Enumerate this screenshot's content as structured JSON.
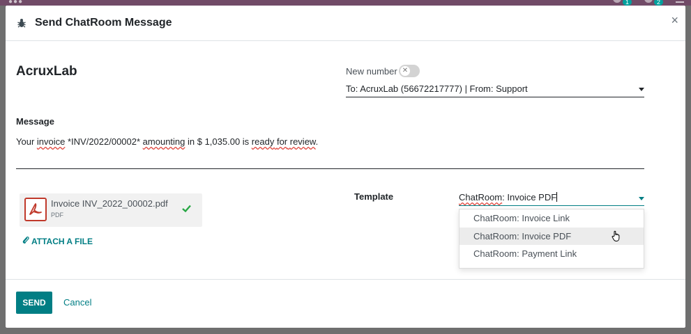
{
  "dialog": {
    "title": "Send ChatRoom Message",
    "close_symbol": "×"
  },
  "partner": {
    "name": "AcruxLab"
  },
  "new_number": {
    "label": "New number",
    "enabled": false
  },
  "conversation": {
    "selected": "To: AcruxLab (56672217777) | From: Support"
  },
  "message": {
    "label": "Message",
    "parts": {
      "p1": "Your ",
      "p2": "invoice",
      "p3": " *INV/2022/00002* ",
      "p4": "amounting",
      "p5": " in $ 1,035.00 is ",
      "p6": "ready",
      "p7": " ",
      "p8": "for",
      "p9": " ",
      "p10": "review",
      "p11": "."
    }
  },
  "attachment": {
    "name": "Invoice INV_2022_00002.pdf",
    "type": "PDF",
    "attach_label": "ATTACH A FILE"
  },
  "template": {
    "label": "Template",
    "value_part1": "ChatRoom",
    "value_part2": ": Invoice PDF",
    "options": [
      {
        "label": "ChatRoom: Invoice Link"
      },
      {
        "label": "ChatRoom: Invoice PDF"
      },
      {
        "label": "ChatRoom: Payment Link"
      }
    ],
    "highlighted_index": 1
  },
  "footer": {
    "send_label": "SEND",
    "cancel_label": "Cancel"
  },
  "navbar": {
    "badge_1": "1",
    "badge_2": "2"
  },
  "colors": {
    "accent": "#017e84",
    "navbar": "#714b67",
    "pdf_red": "#c0392b",
    "check_green": "#28a745"
  }
}
